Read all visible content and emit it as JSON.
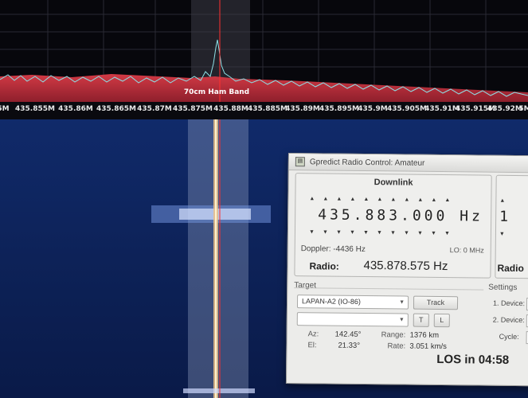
{
  "sdr": {
    "freq_ticks": [
      "5M",
      "435.855M",
      "435.86M",
      "435.865M",
      "435.87M",
      "435.875M",
      "435.88M",
      "435.885M",
      "435.89M",
      "435.895M",
      "435.9M",
      "435.905M",
      "435.91M",
      "435.915M",
      "435.92M",
      "5M"
    ],
    "band_label": "70cm Ham Band",
    "colors": {
      "background": "#0b1430",
      "spectrum_band": "#c1303c",
      "signal_trace": "#8ee0e6",
      "marker": "#ff3030"
    }
  },
  "gpredict": {
    "title": "Gpredict Radio Control: Amateur",
    "downlink": {
      "frame_title": "Downlink",
      "digits": "435.883.000",
      "unit": "Hz",
      "doppler": "Doppler: -4436 Hz",
      "lo": "LO: 0 MHz",
      "radio_label": "Radio:",
      "radio_freq": "435.878.575 Hz"
    },
    "uplink_partial": {
      "digit": "1",
      "radio_label": "Radio"
    },
    "target": {
      "section_title": "Target",
      "satellite": "LAPAN-A2 (IO-86)",
      "track_label": "Track",
      "t_label": "T",
      "l_label": "L",
      "az_label": "Az:",
      "az_value": "142.45°",
      "el_label": "El:",
      "el_value": "21.33°",
      "range_label": "Range:",
      "range_value": "1376 km",
      "rate_label": "Rate:",
      "rate_value": "3.051 km/s",
      "los": "LOS in 04:58"
    },
    "settings": {
      "section_title": "Settings",
      "device1_label": "1. Device:",
      "device2_label": "2. Device:",
      "cycle_label": "Cycle:"
    }
  }
}
